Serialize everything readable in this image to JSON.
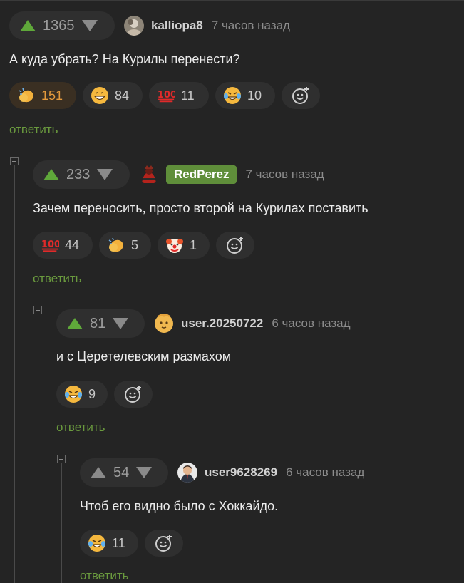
{
  "comments": [
    {
      "score": "1365",
      "username": "kalliopa8",
      "time": "7 часов назад",
      "text": "А куда убрать? На Курилы перенести?",
      "reactions": [
        {
          "emoji": "clapping-hands",
          "count": "151",
          "active": true
        },
        {
          "emoji": "grinning-face",
          "count": "84"
        },
        {
          "emoji": "hundred-points",
          "count": "11"
        },
        {
          "emoji": "tears-of-joy",
          "count": "10"
        }
      ],
      "reply": "ответить"
    },
    {
      "score": "233",
      "username": "RedPerez",
      "time": "7 часов назад",
      "text": "Зачем переносить, просто второй на Курилах поставить",
      "reactions": [
        {
          "emoji": "hundred-points",
          "count": "44"
        },
        {
          "emoji": "clapping-hands",
          "count": "5"
        },
        {
          "emoji": "clown-face",
          "count": "1"
        }
      ],
      "reply": "ответить"
    },
    {
      "score": "81",
      "username": "user.20250722",
      "time": "6 часов назад",
      "text": "и с Церетелевским размахом",
      "reactions": [
        {
          "emoji": "tears-of-joy",
          "count": "9"
        }
      ],
      "reply": "ответить"
    },
    {
      "score": "54",
      "username": "user9628269",
      "time": "6 часов назад",
      "text": "Чтоб его видно было с Хоккайдо.",
      "reactions": [
        {
          "emoji": "tears-of-joy",
          "count": "11"
        }
      ],
      "reply": "ответить"
    }
  ],
  "colors": {
    "background": "#242424",
    "upvote": "#5fa83a",
    "reply_link": "#6a9a3e",
    "username_badge": "#5f8e3a",
    "active_reaction_count": "#e59a3c"
  }
}
